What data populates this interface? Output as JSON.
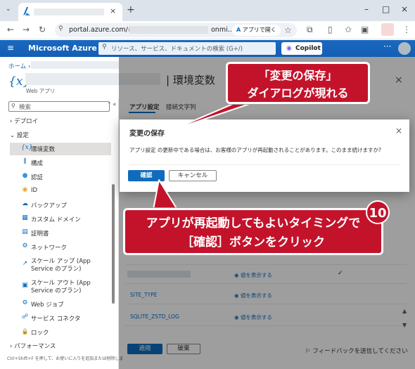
{
  "browser": {
    "tab_close": "×",
    "new_tab": "+",
    "url_prefix": "portal.azure.com/#@",
    "url_suffix": "onmi...",
    "app_open_label": "アプリで開く",
    "win_min": "–",
    "win_max": "□",
    "win_close": "×"
  },
  "azure_header": {
    "brand": "Microsoft Azure",
    "search_placeholder": "リソース、サービス、ドキュメントの検索 (G+/)",
    "copilot_label": "Copilot",
    "more": "···"
  },
  "page": {
    "breadcrumb_home": "ホーム ›",
    "resource_icon": "{x}",
    "title": "| 環境変数",
    "subtitle": "Web アプリ",
    "close": "×",
    "tabs": [
      {
        "label": "アプリ設定"
      },
      {
        "label": "接続文字列"
      }
    ],
    "rows": [
      {
        "name": "",
        "value": "値を表示する",
        "check": "✓"
      },
      {
        "name": "SITE_TYPE",
        "value": "値を表示する",
        "check": ""
      },
      {
        "name": "SQLITE_ZSTD_LOG",
        "value": "値を表示する",
        "check": ""
      }
    ],
    "apply_label": "適用",
    "discard_label": "破棄",
    "feedback_label": "フィードバックを送信してください"
  },
  "sidebar": {
    "search_placeholder": "検索",
    "collapse": "«",
    "groups": [
      {
        "label": "› デプロイ"
      },
      {
        "label": "⌄ 設定"
      },
      {
        "label": "› パフォーマンス"
      }
    ],
    "items": [
      {
        "label": "環境変数",
        "icon": "{x}",
        "color": "#0f6cbd"
      },
      {
        "label": "構成",
        "icon": "⫼",
        "color": "#0f6cbd"
      },
      {
        "label": "認証",
        "icon": "●",
        "color": "#3a96dd"
      },
      {
        "label": "ID",
        "icon": "◉",
        "color": "#e8a317"
      },
      {
        "label": "バックアップ",
        "icon": "☁",
        "color": "#0f6cbd"
      },
      {
        "label": "カスタム ドメイン",
        "icon": "▦",
        "color": "#0f6cbd"
      },
      {
        "label": "証明書",
        "icon": "▤",
        "color": "#0f6cbd"
      },
      {
        "label": "ネットワーク",
        "icon": "⚙",
        "color": "#0f6cbd"
      },
      {
        "label": "スケール アップ (App",
        "label2": "Service のプラン)",
        "icon": "↗",
        "color": "#0f6cbd"
      },
      {
        "label": "スケール アウト (App",
        "label2": "Service のプラン)",
        "icon": "▣",
        "color": "#0f6cbd"
      },
      {
        "label": "Web ジョブ",
        "icon": "⚙",
        "color": "#0f6cbd"
      },
      {
        "label": "サービス コネクタ",
        "icon": "☍",
        "color": "#0f6cbd"
      },
      {
        "label": "ロック",
        "icon": "🔒",
        "color": "#0f6cbd"
      }
    ],
    "hint": "Ctrl+Shift+F を押して、お使いに入りを追加または削除しま"
  },
  "modal": {
    "title": "変更の保存",
    "close": "×",
    "body": "アプリ設定 の更新中である場合は、お客様のアプリが再起動されることがあります。このまま続けますか?",
    "confirm_label": "確認",
    "cancel_label": "キャンセル"
  },
  "annotations": {
    "callout1_line1": "「変更の保存」",
    "callout1_line2": "ダイアログが現れる",
    "callout2_line1": "アプリが再起動してもよいタイミングで",
    "callout2_line2": "［確認］ボタンをクリック",
    "step_number": "10",
    "accent_color": "#c3132b"
  }
}
